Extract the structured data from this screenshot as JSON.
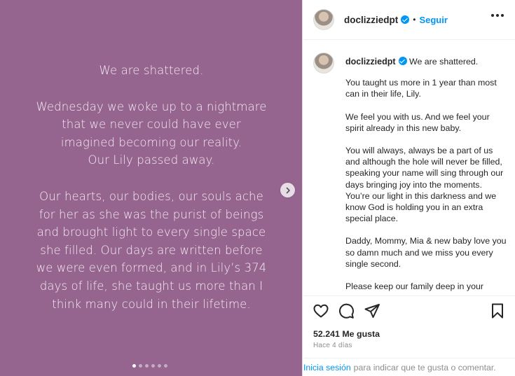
{
  "media": {
    "title": "We are shattered.",
    "paragraph1": [
      "Wednesday we woke up to a nightmare",
      "that we never could have ever",
      "imagined becoming our reality.",
      "Our Lily passed away."
    ],
    "paragraph2": [
      "Our hearts, our bodies, our souls ache",
      "for her as she was the purist of beings",
      "and brought light to every single space",
      "she filled. Our days are written before",
      "we were even formed, and in Lily’s 374",
      "days of life, she taught us more than I",
      "think many could in their lifetime."
    ],
    "background_color": "#95648f",
    "carousel_dots": 6,
    "carousel_active_index": 0
  },
  "header": {
    "username": "doclizziedpt",
    "separator": "•",
    "follow_label": "Seguir"
  },
  "caption": {
    "username": "doclizziedpt",
    "headline": "We are shattered.",
    "paragraphs": [
      "You taught us more in 1 year than most can in their life, Lily.",
      "We feel you with us. And we feel your spirit already in this new baby.",
      "You will always, always be a part of us and although the hole will never be filled, speaking your name will sing through our days bringing joy into the moments. You’re our light in this darkness and we know God is holding you in an extra special place.",
      "Daddy, Mommy, Mia & new baby love you so damn much and we miss you every single second.",
      "Please keep our family deep in your"
    ]
  },
  "actions": {
    "like_icon": "heart-icon",
    "comment_icon": "comment-icon",
    "share_icon": "send-icon",
    "save_icon": "bookmark-icon"
  },
  "stats": {
    "likes": "52.241 Me gusta",
    "time": "Hace 4 días"
  },
  "footer": {
    "login_link": "Inicia sesión",
    "rest": "para indicar que te gusta o comentar."
  },
  "colors": {
    "accent": "#0095f6",
    "text": "#262626",
    "muted": "#8e8e8e"
  }
}
